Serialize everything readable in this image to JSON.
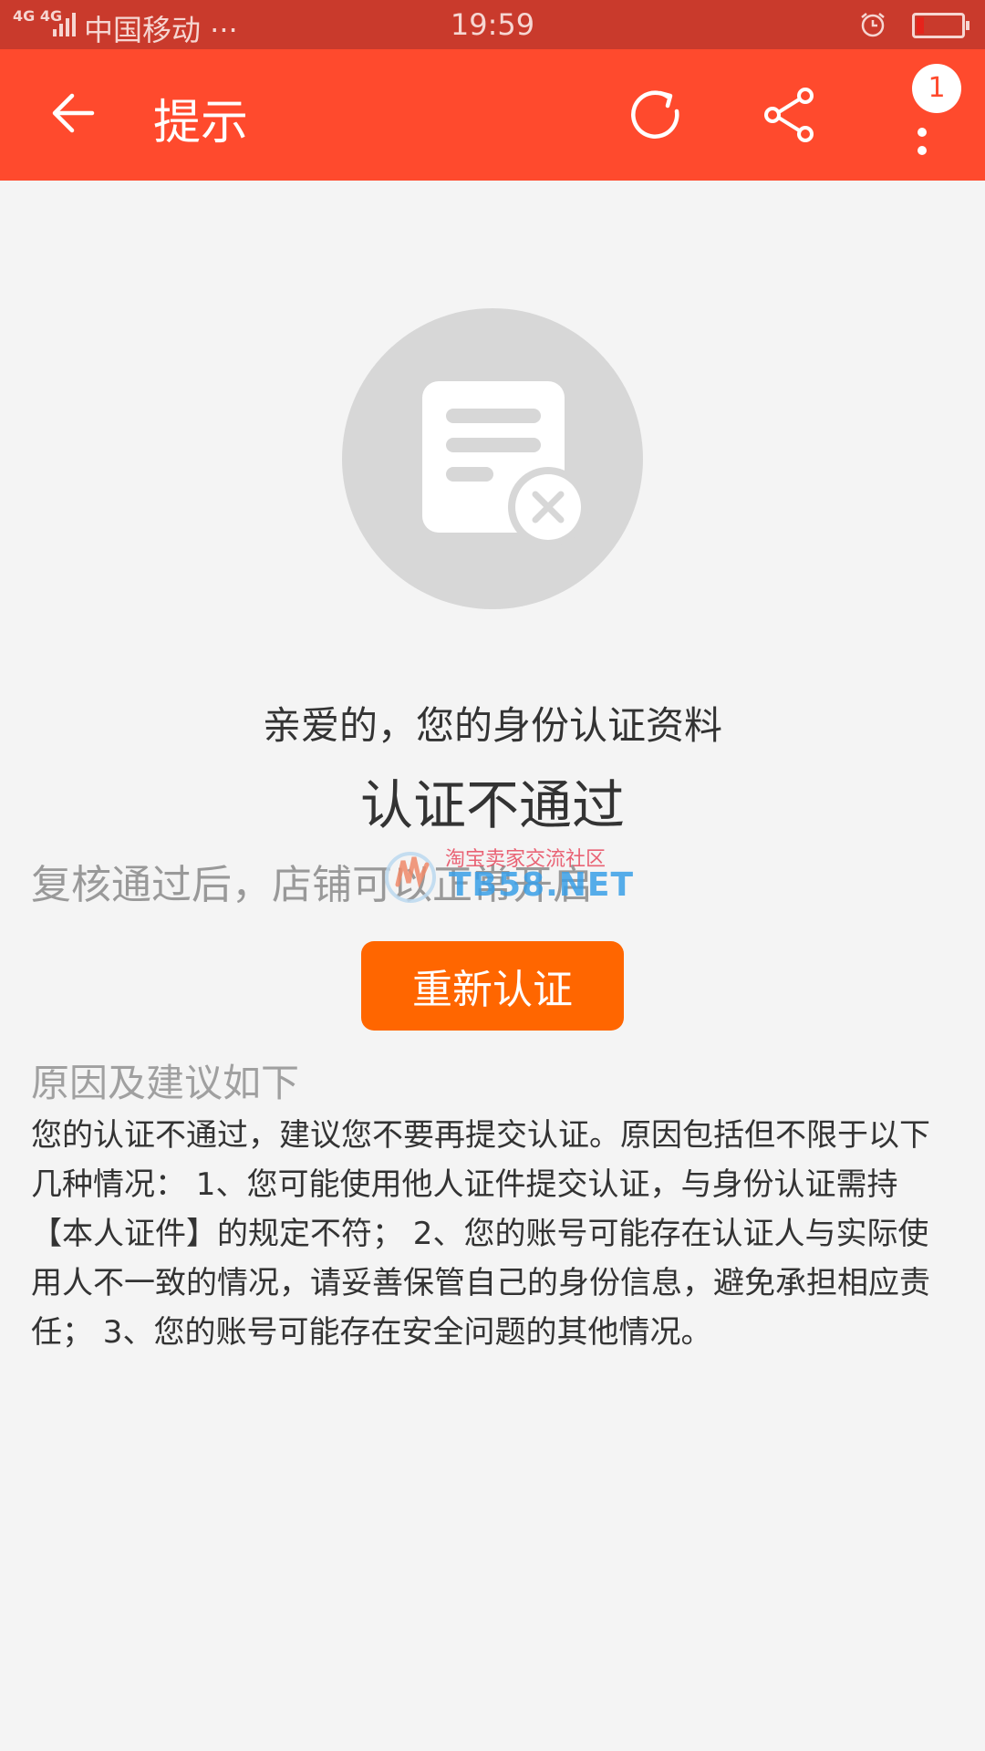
{
  "status_bar": {
    "network": "4G 4G",
    "carrier": "中国移动 ···",
    "time": "19:59",
    "alarm_icon": "alarm-clock-icon",
    "battery_icon": "battery-low-icon"
  },
  "header": {
    "title": "提示",
    "back_icon": "back-arrow-icon",
    "refresh_icon": "refresh-icon",
    "share_icon": "share-icon",
    "more_icon": "more-vertical-icon",
    "badge_count": "1",
    "background": "#ff4a2d"
  },
  "illustration": {
    "icon": "document-rejected-icon"
  },
  "message": {
    "line1": "亲爱的，您的身份认证资料",
    "line2": "认证不通过",
    "line3": "复核通过后，店铺可以正常开启"
  },
  "watermark": {
    "line1": "淘宝卖家交流社区",
    "line2": "TB58.NET"
  },
  "reauth_button": {
    "label": "重新认证",
    "color": "#ff6600"
  },
  "reasons": {
    "title": "原因及建议如下",
    "body": "您的认证不通过，建议您不要再提交认证。原因包括但不限于以下几种情况： 1、您可能使用他人证件提交认证，与身份认证需持【本人证件】的规定不符； 2、您的账号可能存在认证人与实际使用人不一致的情况，请妥善保管自己的身份信息，避免承担相应责任； 3、您的账号可能存在安全问题的其他情况。"
  }
}
